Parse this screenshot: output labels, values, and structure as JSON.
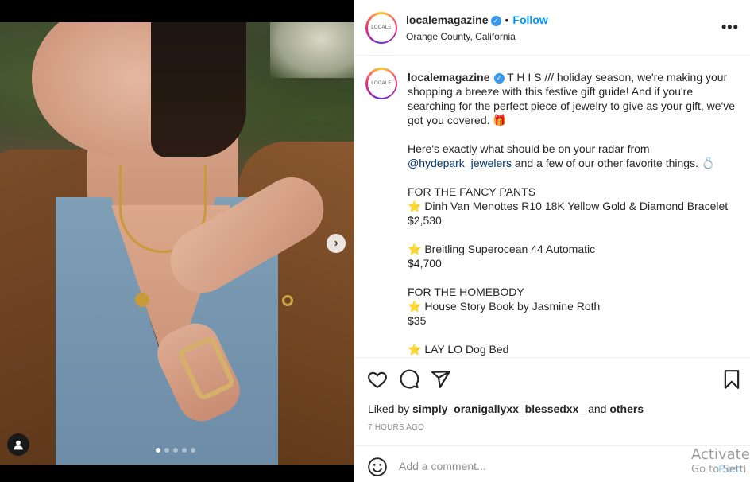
{
  "post": {
    "username": "localemagazine",
    "avatar_text": "LOCALE",
    "separator": "•",
    "follow_label": "Follow",
    "location": "Orange County, California",
    "more_label": "•••",
    "caption_lines": [
      "T H I S /// holiday season, we're making your shopping a breeze with this festive gift guide! And if you're searching for the perfect piece of jewelry to give as your gift, we've got you covered. 🎁",
      "Here's exactly what should be on your radar from",
      "@hydepark_jewelers",
      "and a few of our other favorite things. 💍",
      "FOR THE FANCY PANTS",
      "⭐ Dinh Van Menottes R10 18K Yellow Gold & Diamond Bracelet",
      "$2,530",
      "⭐ Breitling Superocean 44 Automatic",
      "$4,700",
      "FOR THE HOMEBODY",
      "⭐ House Story Book by Jasmine Roth",
      "$35",
      "⭐ LAY LO Dog Bed"
    ],
    "liked_by_prefix": "Liked by",
    "liked_by_user": "simply_oranigallyxx_blessedxx_",
    "liked_by_and": "and",
    "liked_by_others": "others",
    "time_ago": "7 HOURS AGO",
    "comment_placeholder": "Add a comment...",
    "post_label": "Post"
  },
  "carousel": {
    "total": 5,
    "active_index": 0,
    "next_glyph": "›"
  },
  "watermark": {
    "line1": "Activate",
    "line2": "Go to Setti"
  },
  "colors": {
    "link_blue": "#0095f6",
    "mention": "#00376b",
    "muted": "#8e8e8e"
  }
}
